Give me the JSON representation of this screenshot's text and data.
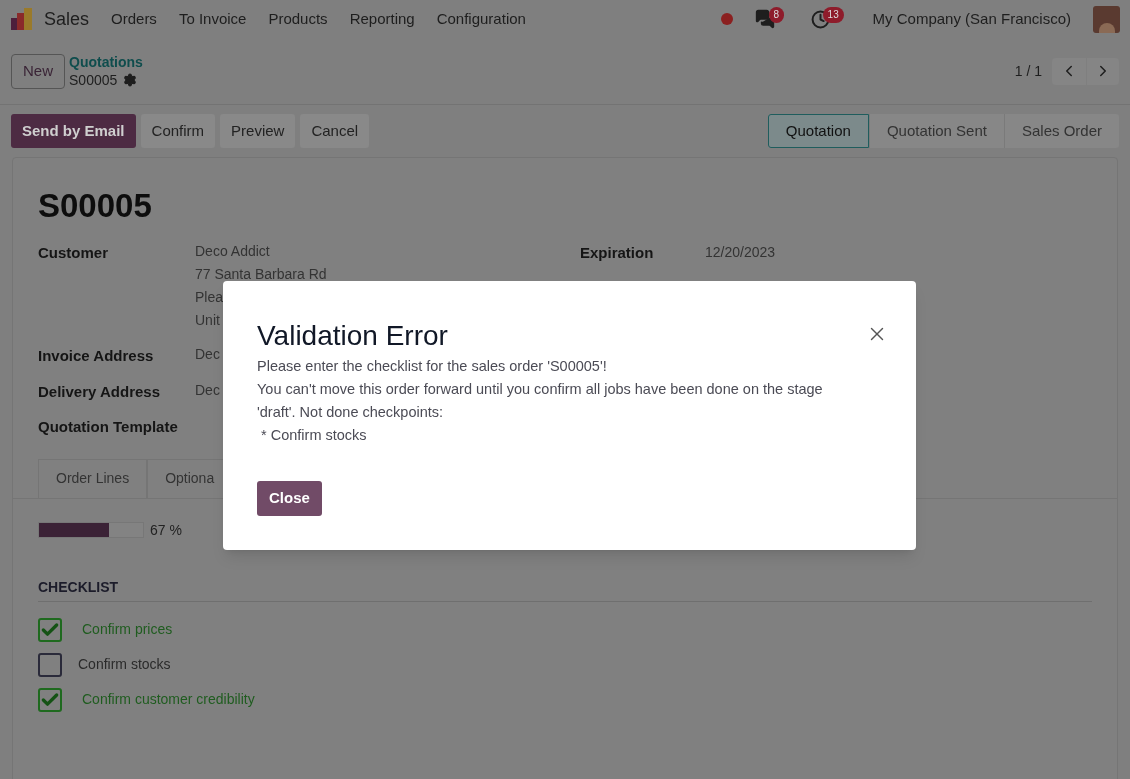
{
  "navbar": {
    "app": "Sales",
    "menu": [
      "Orders",
      "To Invoice",
      "Products",
      "Reporting",
      "Configuration"
    ],
    "messages_badge": "8",
    "activities_badge": "13",
    "company": "My Company (San Francisco)"
  },
  "breadcrumb": {
    "new_button": "New",
    "parent": "Quotations",
    "record": "S00005"
  },
  "pager": "1 / 1",
  "actions": [
    {
      "label": "Send by Email",
      "kind": "primary"
    },
    {
      "label": "Confirm",
      "kind": "secondary"
    },
    {
      "label": "Preview",
      "kind": "secondary"
    },
    {
      "label": "Cancel",
      "kind": "secondary"
    }
  ],
  "stages": [
    {
      "label": "Quotation",
      "selected": true
    },
    {
      "label": "Quotation Sent",
      "selected": false
    },
    {
      "label": "Sales Order",
      "selected": false
    }
  ],
  "title": "S00005",
  "fields_left": [
    {
      "label": "Customer",
      "lines": [
        "Deco Addict",
        "77 Santa Barbara Rd",
        "Plea",
        "Unit"
      ]
    },
    {
      "label": "Invoice Address",
      "lines": [
        "Dec"
      ]
    },
    {
      "label": "Delivery Address",
      "lines": [
        "Dec"
      ]
    },
    {
      "label": "Quotation Template"
    }
  ],
  "fields_right": [
    {
      "label": "Expiration",
      "value": "12/20/2023"
    }
  ],
  "tabs": [
    {
      "label": "Order Lines",
      "selected": false
    },
    {
      "label": "Optiona",
      "selected": false
    }
  ],
  "progress": {
    "level": 0.67,
    "label": "67 %"
  },
  "checklist": {
    "heading": "CHECKLIST",
    "items": [
      {
        "label": "Confirm prices",
        "checked": true
      },
      {
        "label": "Confirm stocks",
        "checked": false
      },
      {
        "label": "Confirm customer credibility",
        "checked": true
      }
    ]
  },
  "dialog": {
    "title": "Validation Error",
    "message": [
      "Please enter the checklist for the sales order 'S00005'!",
      "You can't move this order forward until you confirm all jobs have been done on the stage 'draft'. Not done checkpoints:",
      " * Confirm stocks"
    ],
    "button": "Close"
  }
}
